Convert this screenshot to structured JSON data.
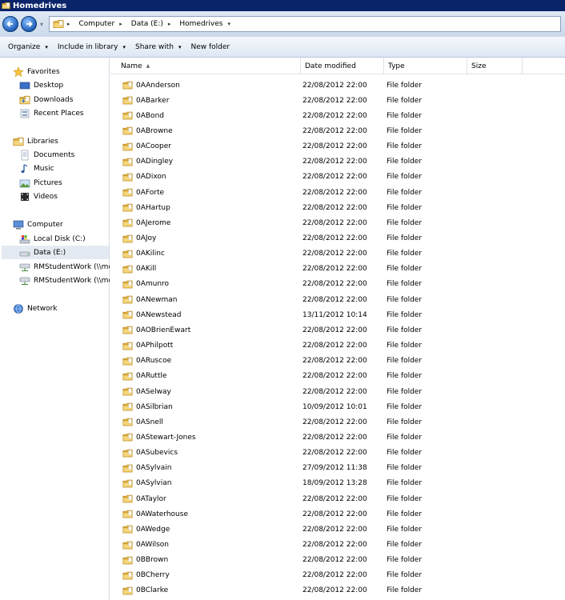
{
  "window": {
    "title": "Homedrives"
  },
  "address": {
    "crumbs": [
      "Computer",
      "Data (E:)",
      "Homedrives"
    ]
  },
  "toolbar": {
    "organize": "Organize",
    "include_library": "Include in library",
    "share_with": "Share with",
    "new_folder": "New folder"
  },
  "nav": {
    "favorites": "Favorites",
    "desktop": "Desktop",
    "downloads": "Downloads",
    "recent_places": "Recent Places",
    "libraries": "Libraries",
    "documents": "Documents",
    "music": "Music",
    "pictures": "Pictures",
    "videos": "Videos",
    "computer": "Computer",
    "local_disk": "Local Disk (C:)",
    "data_drive": "Data (E:)",
    "rm_work_1": "RMStudentWork (\\\\mc",
    "rm_work_2": "RMStudentWork (\\\\mc",
    "network": "Network"
  },
  "columns": {
    "name": "Name",
    "date_modified": "Date modified",
    "type": "Type",
    "size": "Size"
  },
  "files": [
    {
      "name": "0AAnderson",
      "date": "22/08/2012 22:00",
      "type": "File folder"
    },
    {
      "name": "0ABarker",
      "date": "22/08/2012 22:00",
      "type": "File folder"
    },
    {
      "name": "0ABond",
      "date": "22/08/2012 22:00",
      "type": "File folder"
    },
    {
      "name": "0ABrowne",
      "date": "22/08/2012 22:00",
      "type": "File folder"
    },
    {
      "name": "0ACooper",
      "date": "22/08/2012 22:00",
      "type": "File folder"
    },
    {
      "name": "0ADingley",
      "date": "22/08/2012 22:00",
      "type": "File folder"
    },
    {
      "name": "0ADixon",
      "date": "22/08/2012 22:00",
      "type": "File folder"
    },
    {
      "name": "0AForte",
      "date": "22/08/2012 22:00",
      "type": "File folder"
    },
    {
      "name": "0AHartup",
      "date": "22/08/2012 22:00",
      "type": "File folder"
    },
    {
      "name": "0AJerome",
      "date": "22/08/2012 22:00",
      "type": "File folder"
    },
    {
      "name": "0AJoy",
      "date": "22/08/2012 22:00",
      "type": "File folder"
    },
    {
      "name": "0AKilinc",
      "date": "22/08/2012 22:00",
      "type": "File folder"
    },
    {
      "name": "0AKill",
      "date": "22/08/2012 22:00",
      "type": "File folder"
    },
    {
      "name": "0Amunro",
      "date": "22/08/2012 22:00",
      "type": "File folder"
    },
    {
      "name": "0ANewman",
      "date": "22/08/2012 22:00",
      "type": "File folder"
    },
    {
      "name": "0ANewstead",
      "date": "13/11/2012 10:14",
      "type": "File folder"
    },
    {
      "name": "0AOBrienEwart",
      "date": "22/08/2012 22:00",
      "type": "File folder"
    },
    {
      "name": "0APhilpott",
      "date": "22/08/2012 22:00",
      "type": "File folder"
    },
    {
      "name": "0ARuscoe",
      "date": "22/08/2012 22:00",
      "type": "File folder"
    },
    {
      "name": "0ARuttle",
      "date": "22/08/2012 22:00",
      "type": "File folder"
    },
    {
      "name": "0ASelway",
      "date": "22/08/2012 22:00",
      "type": "File folder"
    },
    {
      "name": "0ASilbrian",
      "date": "10/09/2012 10:01",
      "type": "File folder"
    },
    {
      "name": "0ASnell",
      "date": "22/08/2012 22:00",
      "type": "File folder"
    },
    {
      "name": "0AStewart-Jones",
      "date": "22/08/2012 22:00",
      "type": "File folder"
    },
    {
      "name": "0ASubevics",
      "date": "22/08/2012 22:00",
      "type": "File folder"
    },
    {
      "name": "0ASylvain",
      "date": "27/09/2012 11:38",
      "type": "File folder"
    },
    {
      "name": "0ASylvian",
      "date": "18/09/2012 13:28",
      "type": "File folder"
    },
    {
      "name": "0ATaylor",
      "date": "22/08/2012 22:00",
      "type": "File folder"
    },
    {
      "name": "0AWaterhouse",
      "date": "22/08/2012 22:00",
      "type": "File folder"
    },
    {
      "name": "0AWedge",
      "date": "22/08/2012 22:00",
      "type": "File folder"
    },
    {
      "name": "0AWilson",
      "date": "22/08/2012 22:00",
      "type": "File folder"
    },
    {
      "name": "0BBrown",
      "date": "22/08/2012 22:00",
      "type": "File folder"
    },
    {
      "name": "0BCherry",
      "date": "22/08/2012 22:00",
      "type": "File folder"
    },
    {
      "name": "0BClarke",
      "date": "22/08/2012 22:00",
      "type": "File folder"
    }
  ]
}
